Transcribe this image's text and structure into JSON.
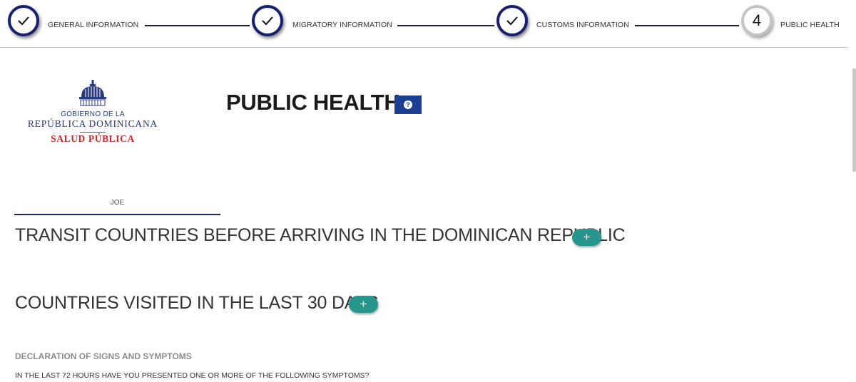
{
  "stepper": {
    "steps": [
      {
        "label": "GENERAL INFORMATION",
        "state": "completed",
        "icon": "check-icon"
      },
      {
        "label": "MIGRATORY INFORMATION",
        "state": "completed",
        "icon": "check-icon"
      },
      {
        "label": "CUSTOMS INFORMATION",
        "state": "completed",
        "icon": "check-icon"
      },
      {
        "label": "PUBLIC HEALTH",
        "state": "current",
        "number": "4"
      }
    ],
    "colors": {
      "completed_ring": "#17206d",
      "current_ring": "#c4c4c4",
      "connector": "#1b1f3a"
    }
  },
  "logo": {
    "line1": "GOBIERNO DE LA",
    "line2": "REPÚBLICA DOMINICANA",
    "line3": "SALUD PÚBLICA",
    "icon": "capitol-dome-icon",
    "colors": {
      "primary": "#2a3a7a",
      "accent": "#d0262c"
    }
  },
  "header": {
    "title": "PUBLIC HEALTH",
    "help_icon": "question-icon",
    "help_glyph": "?",
    "help_color": "#1c3f94"
  },
  "traveler_tab": {
    "label": "JOE"
  },
  "sections": {
    "transit": {
      "title": "TRANSIT COUNTRIES BEFORE ARRIVING IN THE DOMINICAN REPUBLIC",
      "add_label": "+"
    },
    "visited": {
      "title": "COUNTRIES VISITED IN THE LAST 30 DAYS",
      "add_label": "+"
    },
    "add_button_color": "#26968c"
  },
  "declaration": {
    "heading": "DECLARATION OF SIGNS AND SYMPTOMS",
    "question": "IN THE LAST 72 HOURS HAVE YOU PRESENTED ONE OR MORE OF THE FOLLOWING SYMPTOMS?"
  }
}
